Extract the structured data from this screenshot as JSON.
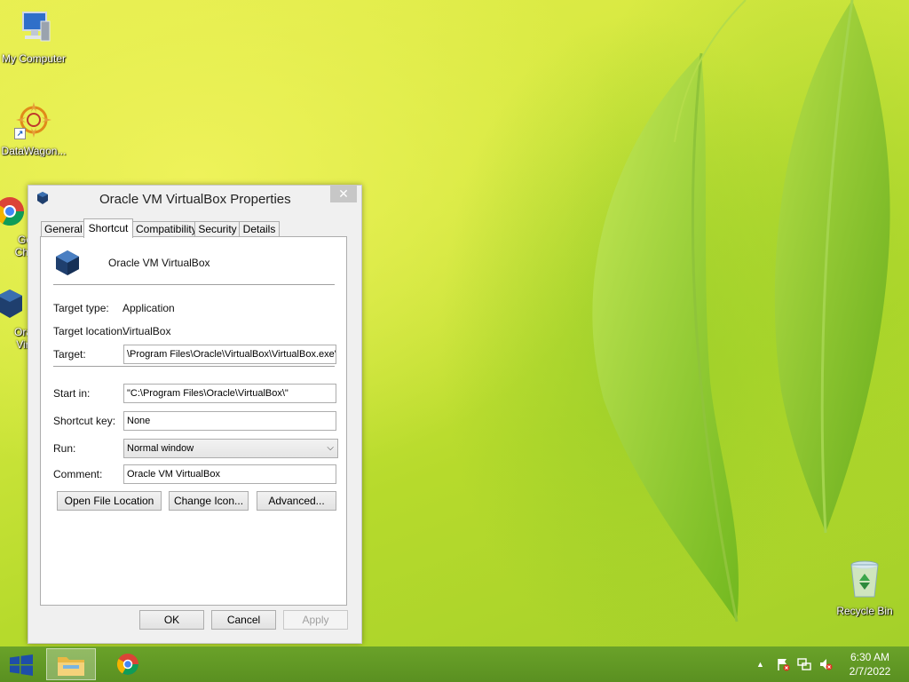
{
  "desktop": {
    "icons": [
      {
        "label": "My Computer",
        "icon": "computer-icon"
      },
      {
        "label": "DataWagon...",
        "icon": "datawagon-icon"
      },
      {
        "label": "Go\nChr",
        "icon": "chrome-icon"
      },
      {
        "label": "Ora\nVirt",
        "icon": "virtualbox-icon"
      },
      {
        "label": "Recycle Bin",
        "icon": "recycle-bin-icon"
      }
    ]
  },
  "dialog": {
    "title": "Oracle VM VirtualBox Properties",
    "close_glyph": "✕",
    "tabs": [
      {
        "label": "General"
      },
      {
        "label": "Shortcut",
        "active": true
      },
      {
        "label": "Compatibility"
      },
      {
        "label": "Security"
      },
      {
        "label": "Details"
      }
    ],
    "shortcut": {
      "app_name": "Oracle VM VirtualBox",
      "target_type_label": "Target type:",
      "target_type_value": "Application",
      "target_location_label": "Target location:",
      "target_location_value": "VirtualBox",
      "target_label": "Target:",
      "target_value": "\\Program Files\\Oracle\\VirtualBox\\VirtualBox.exe\"",
      "start_in_label": "Start in:",
      "start_in_value": "\"C:\\Program Files\\Oracle\\VirtualBox\\\"",
      "shortcut_key_label": "Shortcut key:",
      "shortcut_key_value": "None",
      "run_label": "Run:",
      "run_value": "Normal window",
      "comment_label": "Comment:",
      "comment_value": "Oracle VM VirtualBox",
      "open_file_location": "Open File Location",
      "change_icon": "Change Icon...",
      "advanced": "Advanced..."
    },
    "buttons": {
      "ok": "OK",
      "cancel": "Cancel",
      "apply": "Apply"
    }
  },
  "taskbar": {
    "clock_time": "6:30 AM",
    "clock_date": "2/7/2022",
    "tray_chevron": "▲"
  },
  "colors": {
    "taskbar": "#5e9725",
    "accent": "#1a5fc0"
  }
}
